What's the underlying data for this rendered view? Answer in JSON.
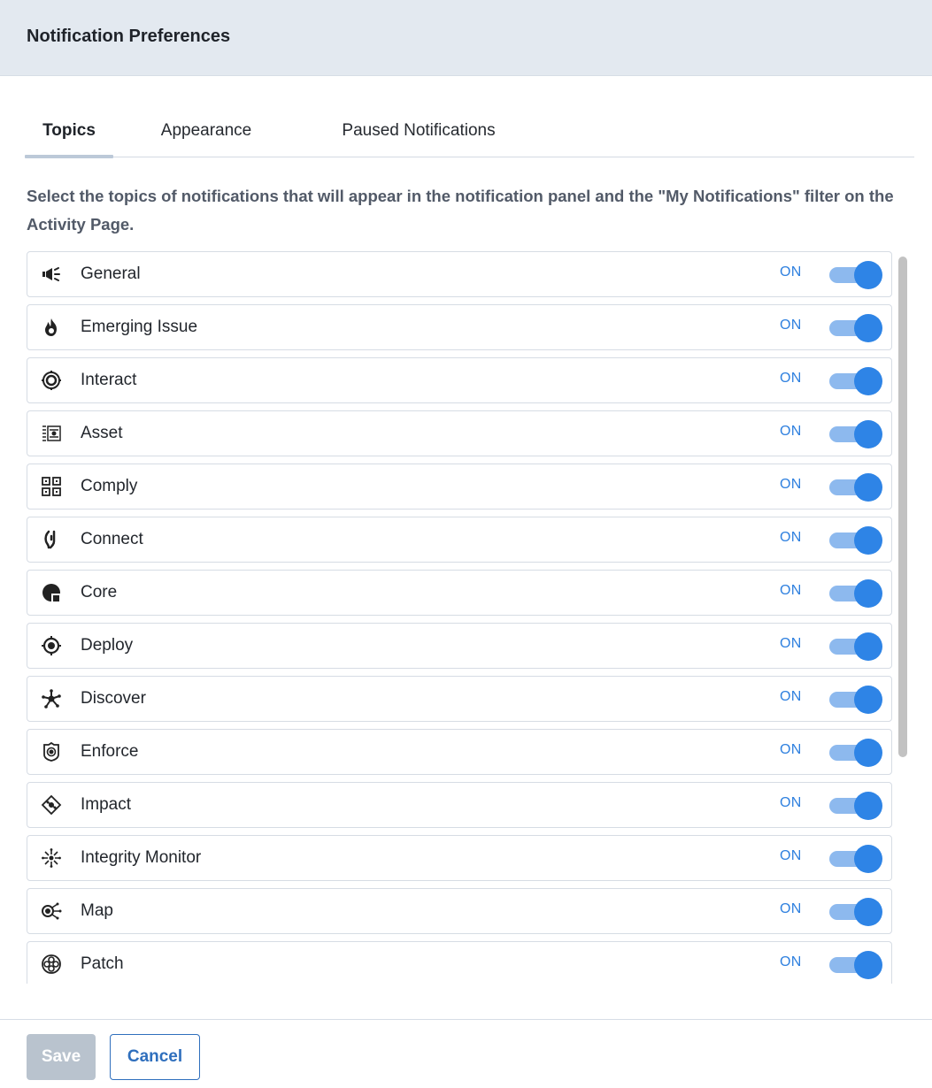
{
  "dialog": {
    "title": "Notification Preferences"
  },
  "tabs": [
    {
      "label": "Topics",
      "active": true
    },
    {
      "label": "Appearance",
      "active": false
    },
    {
      "label": "Paused Notifications",
      "active": false
    }
  ],
  "description": "Select the topics of notifications that will appear in the notification panel and the \"My Notifications\" filter on the Activity Page.",
  "topics": [
    {
      "label": "General",
      "icon": "megaphone-icon",
      "state": "ON"
    },
    {
      "label": "Emerging Issue",
      "icon": "flame-icon",
      "state": "ON"
    },
    {
      "label": "Interact",
      "icon": "interact-icon",
      "state": "ON"
    },
    {
      "label": "Asset",
      "icon": "asset-icon",
      "state": "ON"
    },
    {
      "label": "Comply",
      "icon": "comply-icon",
      "state": "ON"
    },
    {
      "label": "Connect",
      "icon": "connect-icon",
      "state": "ON"
    },
    {
      "label": "Core",
      "icon": "core-icon",
      "state": "ON"
    },
    {
      "label": "Deploy",
      "icon": "deploy-icon",
      "state": "ON"
    },
    {
      "label": "Discover",
      "icon": "discover-icon",
      "state": "ON"
    },
    {
      "label": "Enforce",
      "icon": "enforce-icon",
      "state": "ON"
    },
    {
      "label": "Impact",
      "icon": "impact-icon",
      "state": "ON"
    },
    {
      "label": "Integrity Monitor",
      "icon": "integrity-monitor-icon",
      "state": "ON"
    },
    {
      "label": "Map",
      "icon": "map-icon",
      "state": "ON"
    },
    {
      "label": "Patch",
      "icon": "patch-icon",
      "state": "ON"
    }
  ],
  "footer": {
    "save_label": "Save",
    "cancel_label": "Cancel"
  },
  "colors": {
    "accent": "#2e84e6",
    "toggle_track": "#8db9ee",
    "header_bg": "#e3e9f0",
    "save_disabled": "#b9c3ce"
  }
}
